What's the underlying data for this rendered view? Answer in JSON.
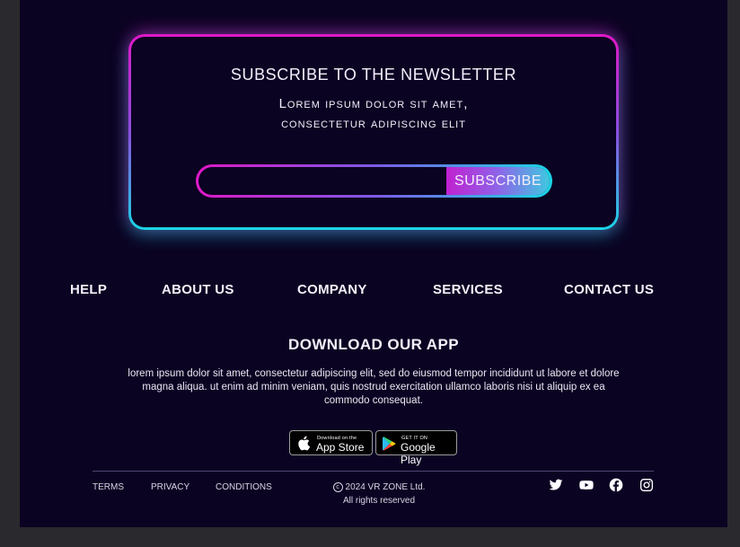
{
  "newsletter": {
    "title": "SUBSCRIBE TO THE NEWSLETTER",
    "subtitle_line1": "Lorem ipsum dolor sit amet,",
    "subtitle_line2": "consectetur adipiscing elit",
    "email_value": "",
    "button_label": "SUBSCRIBE"
  },
  "nav": {
    "help": "HELP",
    "about": "ABOUT US",
    "company": "COMPANY",
    "services": "SERVICES",
    "contact": "CONTACT US"
  },
  "download": {
    "title": "DOWNLOAD OUR APP",
    "text": "lorem ipsum dolor sit amet, consectetur adipiscing elit, sed do eiusmod tempor incididunt ut labore et dolore magna aliqua. ut enim ad minim veniam, quis nostrud exercitation ullamco laboris nisi ut aliquip ex ea commodo consequat.",
    "app_store_small": "Download on the",
    "app_store_big": "App Store",
    "google_play_small": "GET IT ON",
    "google_play_big": "Google Play"
  },
  "footer": {
    "terms": "TERMS",
    "privacy": "PRIVACY",
    "conditions": "CONDITIONS",
    "copyright_line1": "2024 VR ZONE Ltd.",
    "copyright_line2": "All rights reserved",
    "social_icons": [
      "twitter-icon",
      "youtube-icon",
      "facebook-icon",
      "instagram-icon"
    ]
  },
  "colors": {
    "background": "#0b0322",
    "accent_pink": "#e018c8",
    "accent_cyan": "#19d6e6"
  }
}
